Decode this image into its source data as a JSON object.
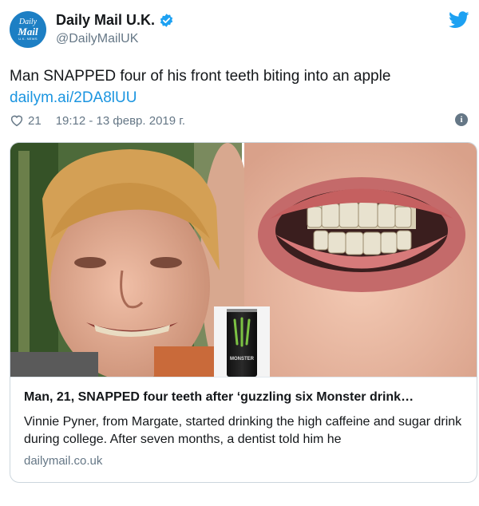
{
  "account": {
    "display_name": "Daily Mail U.K.",
    "handle": "@DailyMailUK",
    "avatar_text": {
      "line1": "Daily",
      "line2": "Mail",
      "line3": "U.K. NEWS"
    },
    "verified": true,
    "verified_icon": "verified-badge-icon",
    "brand_icon": "twitter-bird-icon"
  },
  "tweet": {
    "text": "Man SNAPPED four of his front teeth biting into an apple",
    "link": "dailym.ai/2DA8lUU",
    "likes": "21",
    "timestamp": "19:12 - 13 февр. 2019 г.",
    "like_icon": "heart-icon",
    "info_icon": "info-icon",
    "info_glyph": "i"
  },
  "card": {
    "title": "Man, 21, SNAPPED four teeth after ‘guzzling six Monster drink…",
    "description": "Vinnie Pyner, from Margate, started drinking the high caffeine and sugar drink during college. After seven months, a dentist told him he",
    "domain": "dailymail.co.uk",
    "can_label": "MONSTER"
  },
  "colors": {
    "accent": "#1b95e0",
    "verified": "#1da1f2",
    "secondary_text": "#657786",
    "avatar_bg": "#1d7fc4",
    "can_green": "#7cc243"
  }
}
